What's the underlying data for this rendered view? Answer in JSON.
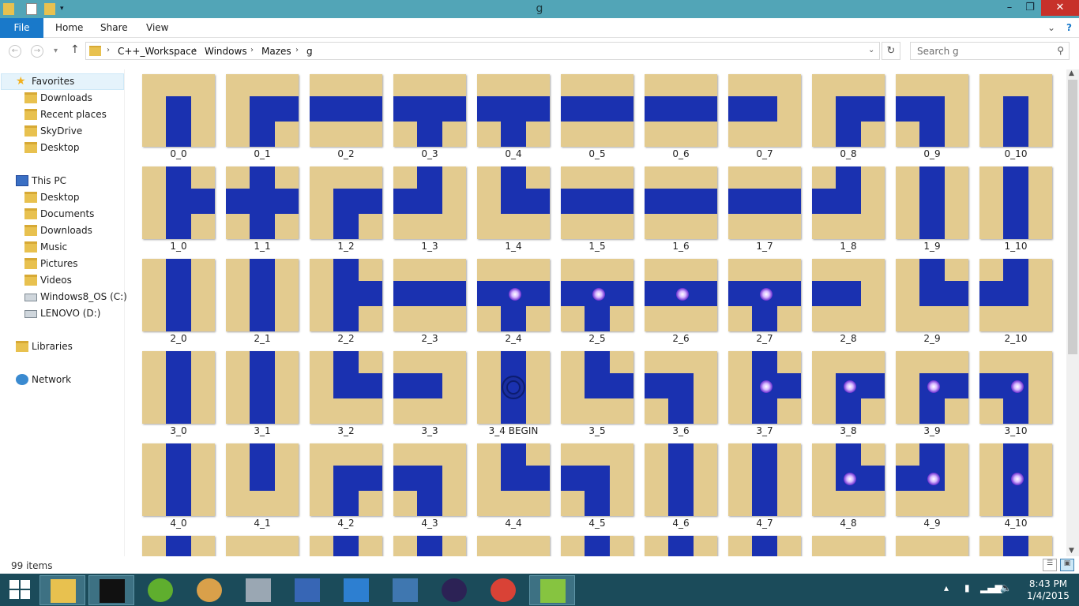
{
  "window": {
    "title": "g"
  },
  "ribbon": {
    "tabs": [
      "File",
      "Home",
      "Share",
      "View"
    ]
  },
  "address": {
    "segments": [
      "C++_Workspace",
      "Windows",
      "Mazes",
      "g"
    ],
    "search_placeholder": "Search g"
  },
  "sidebar": {
    "favorites": {
      "label": "Favorites",
      "items": [
        "Downloads",
        "Recent places",
        "SkyDrive",
        "Desktop"
      ]
    },
    "this_pc": {
      "label": "This PC",
      "items": [
        "Desktop",
        "Documents",
        "Downloads",
        "Music",
        "Pictures",
        "Videos",
        "Windows8_OS (C:)",
        "LENOVO (D:)"
      ]
    },
    "libraries": "Libraries",
    "network": "Network"
  },
  "files": [
    {
      "name": "0_0",
      "tile": "S"
    },
    {
      "name": "0_1",
      "tile": "ES"
    },
    {
      "name": "0_2",
      "tile": "EW"
    },
    {
      "name": "0_3",
      "tile": "ESW"
    },
    {
      "name": "0_4",
      "tile": "ESW"
    },
    {
      "name": "0_5",
      "tile": "EW"
    },
    {
      "name": "0_6",
      "tile": "EW"
    },
    {
      "name": "0_7",
      "tile": "W"
    },
    {
      "name": "0_8",
      "tile": "ES"
    },
    {
      "name": "0_9",
      "tile": "SW"
    },
    {
      "name": "0_10",
      "tile": "S"
    },
    {
      "name": "1_0",
      "tile": "NES"
    },
    {
      "name": "1_1",
      "tile": "NESW"
    },
    {
      "name": "1_2",
      "tile": "ES"
    },
    {
      "name": "1_3",
      "tile": "NW"
    },
    {
      "name": "1_4",
      "tile": "NE"
    },
    {
      "name": "1_5",
      "tile": "EW"
    },
    {
      "name": "1_6",
      "tile": "EW"
    },
    {
      "name": "1_7",
      "tile": "EW"
    },
    {
      "name": "1_8",
      "tile": "NW"
    },
    {
      "name": "1_9",
      "tile": "NS"
    },
    {
      "name": "1_10",
      "tile": "NS"
    },
    {
      "name": "2_0",
      "tile": "NS"
    },
    {
      "name": "2_1",
      "tile": "NS"
    },
    {
      "name": "2_2",
      "tile": "NES"
    },
    {
      "name": "2_3",
      "tile": "EW"
    },
    {
      "name": "2_4",
      "tile": "ESW",
      "item": "glow"
    },
    {
      "name": "2_5",
      "tile": "ESW",
      "item": "glow"
    },
    {
      "name": "2_6",
      "tile": "EW",
      "item": "glow"
    },
    {
      "name": "2_7",
      "tile": "ESW",
      "item": "glow"
    },
    {
      "name": "2_8",
      "tile": "W"
    },
    {
      "name": "2_9",
      "tile": "NE"
    },
    {
      "name": "2_10",
      "tile": "NW"
    },
    {
      "name": "3_0",
      "tile": "NS"
    },
    {
      "name": "3_1",
      "tile": "NS"
    },
    {
      "name": "3_2",
      "tile": "NE"
    },
    {
      "name": "3_3",
      "tile": "W"
    },
    {
      "name": "3_4 BEGIN",
      "tile": "NS",
      "item": "swirl"
    },
    {
      "name": "3_5",
      "tile": "NE"
    },
    {
      "name": "3_6",
      "tile": "SW"
    },
    {
      "name": "3_7",
      "tile": "NES",
      "item": "glow"
    },
    {
      "name": "3_8",
      "tile": "ES",
      "item": "glow"
    },
    {
      "name": "3_9",
      "tile": "ES",
      "item": "glow"
    },
    {
      "name": "3_10",
      "tile": "SW",
      "item": "glow"
    },
    {
      "name": "4_0",
      "tile": "NS"
    },
    {
      "name": "4_1",
      "tile": "N"
    },
    {
      "name": "4_2",
      "tile": "ES"
    },
    {
      "name": "4_3",
      "tile": "SW"
    },
    {
      "name": "4_4",
      "tile": "NE"
    },
    {
      "name": "4_5",
      "tile": "SW"
    },
    {
      "name": "4_6",
      "tile": "NS"
    },
    {
      "name": "4_7",
      "tile": "NS"
    },
    {
      "name": "4_8",
      "tile": "NE",
      "item": "glow"
    },
    {
      "name": "4_9",
      "tile": "NW",
      "item": "glow"
    },
    {
      "name": "4_10",
      "tile": "NS",
      "item": "glow"
    },
    {
      "name": "",
      "tile": "N"
    },
    {
      "name": "",
      "tile": ""
    },
    {
      "name": "",
      "tile": "N"
    },
    {
      "name": "",
      "tile": "N"
    },
    {
      "name": "",
      "tile": ""
    },
    {
      "name": "",
      "tile": "N"
    },
    {
      "name": "",
      "tile": "N"
    },
    {
      "name": "",
      "tile": "N"
    },
    {
      "name": "",
      "tile": ""
    },
    {
      "name": "",
      "tile": ""
    },
    {
      "name": "",
      "tile": "N"
    }
  ],
  "status": {
    "item_count": "99 items"
  },
  "colors": {
    "sand": "#e3cb8f",
    "path": "#1a31b0",
    "titlebar": "#52a5b7",
    "taskbar": "#1b4b5a",
    "file_tab": "#1979ca"
  },
  "taskbar": {
    "apps": [
      "start-icon",
      "file-explorer-icon",
      "command-prompt-icon",
      "utorrent-icon",
      "paint-icon",
      "calculator-icon",
      "network-tool-icon",
      "security-icon",
      "python-icon",
      "eclipse-icon",
      "chrome-icon",
      "notepad-plus-icon"
    ],
    "time": "8:43 PM",
    "date": "1/4/2015"
  }
}
